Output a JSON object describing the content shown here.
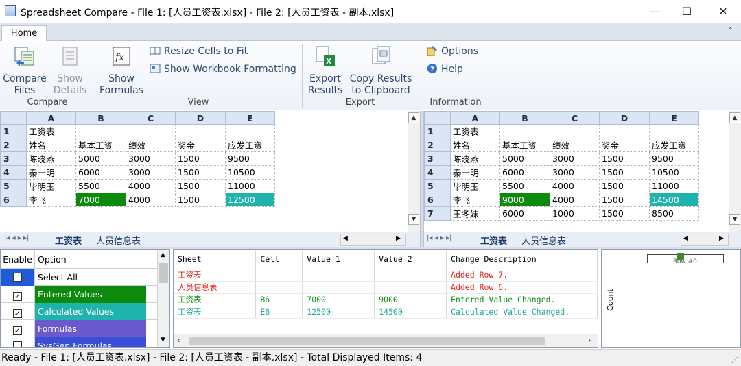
{
  "window": {
    "title": "Spreadsheet Compare - File 1: [人员工资表.xlsx] - File 2: [人员工资表 - 副本.xlsx]",
    "minimize": "—",
    "maximize": "☐",
    "close": "✕"
  },
  "ribbon": {
    "active_tab": "Home",
    "collapse_glyph": "⌃",
    "groups": {
      "compare": {
        "label": "Compare",
        "compare_files_1": "Compare",
        "compare_files_2": "Files",
        "show_details_1": "Show",
        "show_details_2": "Details"
      },
      "view": {
        "label": "View",
        "show_formulas_1": "Show",
        "show_formulas_2": "Formulas",
        "resize_cells": "Resize Cells to Fit",
        "show_workbook_formatting": "Show Workbook Formatting"
      },
      "export": {
        "label": "Export",
        "export_results_1": "Export",
        "export_results_2": "Results",
        "copy_results_1": "Copy Results",
        "copy_results_2": "to Clipboard"
      },
      "information": {
        "label": "Information",
        "options": "Options",
        "help": "Help"
      }
    }
  },
  "left_grid": {
    "columns": [
      "A",
      "B",
      "C",
      "D",
      "E"
    ],
    "rows": [
      {
        "num": "1",
        "cells": [
          "工资表",
          "",
          "",
          "",
          ""
        ]
      },
      {
        "num": "2",
        "cells": [
          "姓名",
          "基本工资",
          "绩效",
          "奖金",
          "应发工资"
        ]
      },
      {
        "num": "3",
        "cells": [
          "陈晓燕",
          "5000",
          "3000",
          "1500",
          "9500"
        ]
      },
      {
        "num": "4",
        "cells": [
          "秦一明",
          "6000",
          "3000",
          "1500",
          "10500"
        ]
      },
      {
        "num": "5",
        "cells": [
          "毕明玉",
          "5500",
          "4000",
          "1500",
          "11000"
        ]
      },
      {
        "num": "6",
        "cells": [
          "李飞",
          "7000",
          "4000",
          "1500",
          "12500"
        ]
      }
    ],
    "sheet_tabs": [
      "工资表",
      "人员信息表"
    ]
  },
  "right_grid": {
    "columns": [
      "A",
      "B",
      "C",
      "D",
      "E"
    ],
    "rows": [
      {
        "num": "1",
        "cells": [
          "工资表",
          "",
          "",
          "",
          ""
        ]
      },
      {
        "num": "2",
        "cells": [
          "姓名",
          "基本工资",
          "绩效",
          "奖金",
          "应发工资"
        ]
      },
      {
        "num": "3",
        "cells": [
          "陈晓燕",
          "5000",
          "3000",
          "1500",
          "9500"
        ]
      },
      {
        "num": "4",
        "cells": [
          "秦一明",
          "6000",
          "3000",
          "1500",
          "10500"
        ]
      },
      {
        "num": "5",
        "cells": [
          "毕明玉",
          "5500",
          "4000",
          "1500",
          "11000"
        ]
      },
      {
        "num": "6",
        "cells": [
          "李飞",
          "9000",
          "4000",
          "1500",
          "14500"
        ]
      },
      {
        "num": "7",
        "cells": [
          "王冬妹",
          "6000",
          "1000",
          "1500",
          "8500"
        ]
      }
    ],
    "sheet_tabs": [
      "工资表",
      "人员信息表"
    ]
  },
  "colors": {
    "entered_value": "#0b8a0b",
    "calculated_value": "#1fb3ad",
    "formulas": "#6a5acd",
    "sysgen_formulas": "#3a4fd8",
    "added_row_text": "#e3241c"
  },
  "options_pane": {
    "header_enable": "Enable",
    "header_option": "Option",
    "items": [
      {
        "label": "Select All",
        "checked": false
      },
      {
        "label": "Entered Values",
        "checked": true
      },
      {
        "label": "Calculated Values",
        "checked": true
      },
      {
        "label": "Formulas",
        "checked": true
      },
      {
        "label": "SysGen Formulas",
        "checked": false
      }
    ]
  },
  "results": {
    "headers": [
      "Sheet",
      "Cell",
      "Value 1",
      "Value 2",
      "Change Description"
    ],
    "rows": [
      {
        "sheet": "工资表",
        "cell": "",
        "value1": "",
        "value2": "",
        "desc": "Added Row 7.",
        "kind": "red"
      },
      {
        "sheet": "人员信息表",
        "cell": "",
        "value1": "",
        "value2": "",
        "desc": "Added Row 6.",
        "kind": "red"
      },
      {
        "sheet": "工资表",
        "cell": "B6",
        "value1": "7000",
        "value2": "9000",
        "desc": "Entered Value Changed.",
        "kind": "green"
      },
      {
        "sheet": "工资表",
        "cell": "E6",
        "value1": "12500",
        "value2": "14500",
        "desc": "Calculated Value Changed.",
        "kind": "teal"
      }
    ]
  },
  "mini_chart": {
    "ylabel": "Count",
    "bar_label": "Row #0"
  },
  "status": {
    "text": "Ready - File 1: [人员工资表.xlsx] - File 2: [人员工资表 - 副本.xlsx] - Total Displayed Items: 4"
  }
}
